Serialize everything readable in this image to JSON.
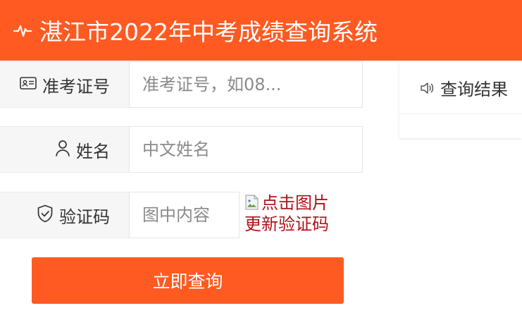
{
  "header": {
    "title": "湛江市2022年中考成绩查询系统",
    "icon": "pulse-icon"
  },
  "form": {
    "exam_id": {
      "label": "准考证号",
      "placeholder": "准考证号，如08...",
      "value": "",
      "icon": "id-card-icon"
    },
    "name": {
      "label": "姓名",
      "placeholder": "中文姓名",
      "value": "",
      "icon": "user-icon"
    },
    "captcha": {
      "label": "验证码",
      "placeholder": "图中内容",
      "value": "",
      "icon": "shield-check-icon",
      "image_alt": "点击图片更新验证码"
    },
    "submit_label": "立即查询"
  },
  "result_panel": {
    "tab_label": "查询结果",
    "icon": "speaker-icon"
  },
  "colors": {
    "accent": "#ff5a22",
    "captcha_text": "#b0131b",
    "label_bg": "#f6f6f6"
  }
}
